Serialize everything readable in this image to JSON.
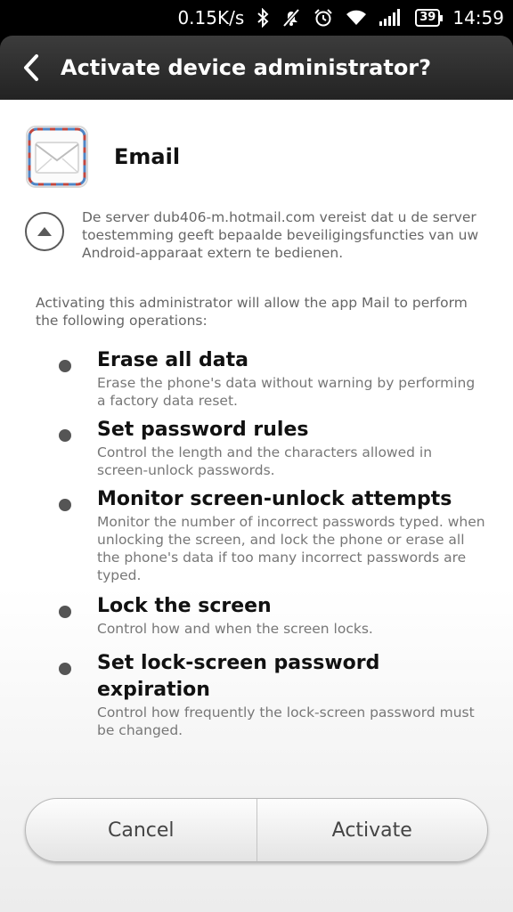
{
  "status_bar": {
    "speed": "0.15K/s",
    "battery": "39",
    "time": "14:59",
    "icons": [
      "bluetooth-icon",
      "mute-icon",
      "alarm-icon",
      "wifi-icon",
      "signal-icon",
      "battery-icon"
    ]
  },
  "header": {
    "title": "Activate device administrator?",
    "back_icon": "back-arrow-icon"
  },
  "app": {
    "name": "Email",
    "icon": "email-envelope-icon"
  },
  "server_message": "De server dub406-m.hotmail.com vereist dat u de server toestemming geeft bepaalde beveiligingsfuncties van uw Android-apparaat extern te bedienen.",
  "intro": "Activating this administrator will allow the app Mail to perform the following operations:",
  "operations": [
    {
      "title": "Erase all data",
      "desc": "Erase the phone's data without warning by performing a factory data reset."
    },
    {
      "title": "Set password rules",
      "desc": "Control the length and the characters allowed in screen-unlock passwords."
    },
    {
      "title": "Monitor screen-unlock attempts",
      "desc": "Monitor the number of incorrect passwords typed. when unlocking the screen, and lock the phone or erase all the phone's data if too many incorrect passwords are typed."
    },
    {
      "title": "Lock the screen",
      "desc": "Control how and when the screen locks."
    },
    {
      "title": "Set lock-screen password expiration",
      "desc": "Control how frequently the lock-screen password must be changed."
    }
  ],
  "buttons": {
    "cancel": "Cancel",
    "activate": "Activate"
  },
  "colors": {
    "header_bg": "#2e2e2e",
    "text_primary": "#111111",
    "text_secondary": "#777777"
  }
}
